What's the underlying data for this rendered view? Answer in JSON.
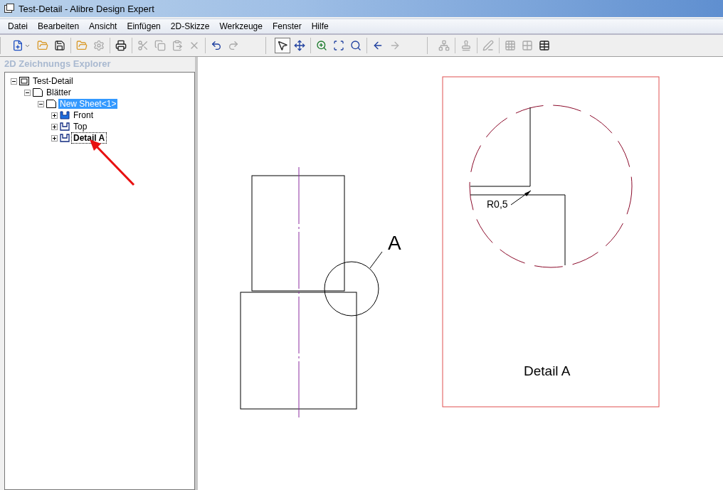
{
  "window": {
    "title": "Test-Detail - Alibre Design Expert"
  },
  "menu": [
    "Datei",
    "Bearbeiten",
    "Ansicht",
    "Einfügen",
    "2D-Skizze",
    "Werkzeuge",
    "Fenster",
    "Hilfe"
  ],
  "toolbars": [
    {
      "groups": [
        [
          {
            "kind": "new",
            "disabled": false,
            "dropdown": true
          },
          {
            "kind": "open",
            "disabled": false
          },
          {
            "kind": "save",
            "disabled": false
          }
        ],
        [
          {
            "kind": "open-folder",
            "disabled": false
          },
          {
            "kind": "settings",
            "disabled": true
          }
        ],
        [
          {
            "kind": "print",
            "disabled": false
          }
        ],
        [
          {
            "kind": "cut",
            "disabled": true
          },
          {
            "kind": "copy",
            "disabled": true
          },
          {
            "kind": "paste",
            "disabled": true
          },
          {
            "kind": "delete",
            "disabled": true
          }
        ],
        [
          {
            "kind": "undo",
            "disabled": false
          },
          {
            "kind": "redo",
            "disabled": true
          }
        ]
      ]
    },
    {
      "groups": [
        [
          {
            "kind": "select",
            "disabled": false,
            "selected": true
          },
          {
            "kind": "fit",
            "disabled": false,
            "selected": false
          }
        ],
        [
          {
            "kind": "zoom-in",
            "disabled": false,
            "selected": false
          },
          {
            "kind": "zoom-window",
            "disabled": false,
            "selected": false
          },
          {
            "kind": "zoom-all",
            "disabled": false,
            "selected": false
          }
        ],
        [
          {
            "kind": "back",
            "disabled": false,
            "selected": false
          },
          {
            "kind": "forward",
            "disabled": true,
            "selected": false
          }
        ]
      ]
    },
    {
      "groups": [
        [
          {
            "kind": "network",
            "disabled": true
          }
        ],
        [
          {
            "kind": "stamp",
            "disabled": true
          }
        ],
        [
          {
            "kind": "pen",
            "disabled": true
          }
        ],
        [
          {
            "kind": "grid",
            "disabled": true
          },
          {
            "kind": "grid-cursor",
            "disabled": true
          },
          {
            "kind": "table",
            "disabled": false
          }
        ]
      ]
    }
  ],
  "explorer": {
    "title": "2D Zeichnungs Explorer",
    "tree": [
      {
        "label": "Test-Detail",
        "kind": "drawing",
        "expanded": true,
        "selected": false,
        "active": false,
        "children": [
          {
            "label": "Blätter",
            "kind": "sheet",
            "expanded": true,
            "selected": false,
            "active": false,
            "children": [
              {
                "label": "New Sheet<1>",
                "kind": "sheet",
                "expanded": true,
                "selected": true,
                "active": false,
                "children": [
                  {
                    "label": "Front",
                    "kind": "view-filled",
                    "expanded": false,
                    "selected": false,
                    "active": false
                  },
                  {
                    "label": "Top",
                    "kind": "view",
                    "expanded": false,
                    "selected": false,
                    "active": false
                  },
                  {
                    "label": "Detail A",
                    "kind": "view",
                    "expanded": false,
                    "selected": false,
                    "active": true
                  }
                ]
              }
            ]
          }
        ]
      }
    ]
  },
  "drawing": {
    "detail_label": "A",
    "radius_label": "R0,5",
    "detail_title": "Detail A"
  }
}
